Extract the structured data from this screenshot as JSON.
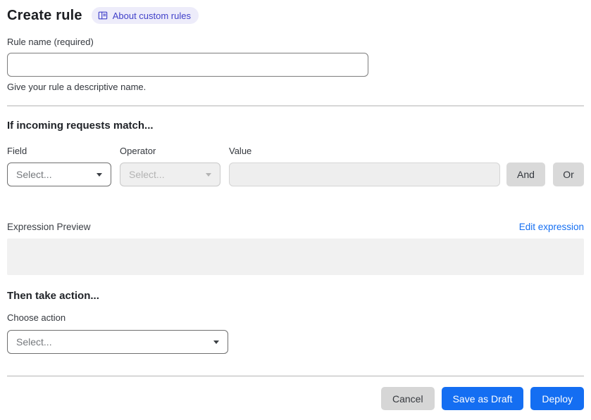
{
  "header": {
    "title": "Create rule",
    "badge_label": "About custom rules",
    "badge_icon": "book-icon"
  },
  "rule_name": {
    "label": "Rule name (required)",
    "value": "",
    "help": "Give your rule a descriptive name."
  },
  "match": {
    "heading": "If incoming requests match...",
    "field_label": "Field",
    "operator_label": "Operator",
    "value_label": "Value",
    "field_value": "Select...",
    "operator_value": "Select...",
    "value_value": "",
    "and_label": "And",
    "or_label": "Or"
  },
  "expression": {
    "label": "Expression Preview",
    "edit_link": "Edit expression",
    "content": ""
  },
  "action": {
    "heading": "Then take action...",
    "choose_label": "Choose action",
    "select_value": "Select..."
  },
  "footer": {
    "cancel_label": "Cancel",
    "save_draft_label": "Save as Draft",
    "deploy_label": "Deploy"
  },
  "colors": {
    "primary_blue": "#146ef2",
    "link_blue": "#156ff2",
    "badge_bg": "#edecfa",
    "badge_text": "#4141c9",
    "divider": "#b4b4b4",
    "disabled_bg": "#efefef",
    "preview_bg": "#f1f1f1",
    "neutral_button_bg": "#d9d9d9"
  },
  "icons": {
    "book": "book-icon",
    "dropdown": "chevron-down-icon"
  }
}
